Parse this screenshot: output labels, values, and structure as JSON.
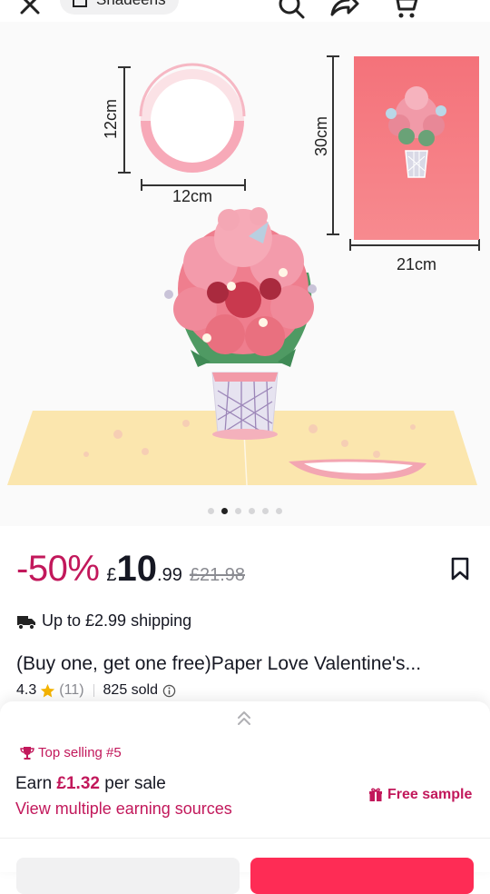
{
  "header": {
    "shop_name": "Shadeens",
    "icons": [
      "close-icon",
      "shop-icon",
      "search-icon",
      "share-icon",
      "cart-icon"
    ]
  },
  "gallery": {
    "dimensions": {
      "round_height": "12cm",
      "round_width": "12cm",
      "card_height": "30cm",
      "card_width": "21cm"
    },
    "image_count": 6,
    "active_index": 1
  },
  "product": {
    "discount": "-50%",
    "currency": "£",
    "price_int": "10",
    "price_dec": ".99",
    "original_price": "£21.98",
    "shipping": "Up to £2.99 shipping",
    "title": "(Buy one, get one free)Paper Love Valentine's...",
    "rating": "4.3",
    "reviews": "(11)",
    "sold": "825 sold"
  },
  "affiliate": {
    "badge": "Top selling #5",
    "earn_prefix": "Earn",
    "earn_amount": "£1.32",
    "earn_suffix": "per sale",
    "view_link": "View multiple earning sources",
    "free_sample": "Free sample"
  },
  "colors": {
    "accent": "#c2185b",
    "primary_button": "#fe2c55",
    "card_pink": "#f4727a",
    "base_yellow": "#fbe6ae"
  }
}
